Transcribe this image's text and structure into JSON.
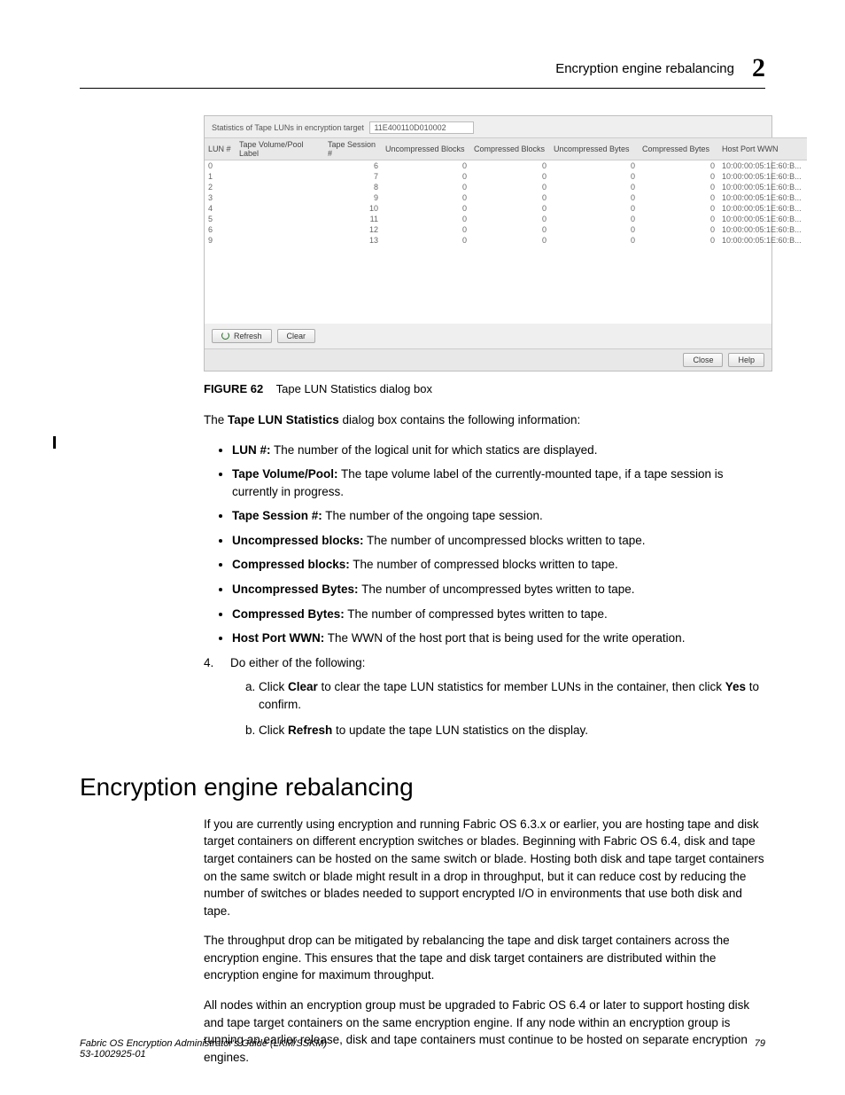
{
  "header": {
    "title": "Encryption engine rebalancing",
    "chapter_number": "2"
  },
  "figure": {
    "stats_label": "Statistics of Tape LUNs in encryption target",
    "target_id": "11E400110D010002",
    "columns": [
      "LUN #",
      "Tape Volume/Pool Label",
      "Tape Session #",
      "Uncompressed Blocks",
      "Compressed Blocks",
      "Uncompressed Bytes",
      "Compressed Bytes",
      "Host Port WWN"
    ],
    "rows": [
      {
        "lun": "0",
        "label": "",
        "session": "6",
        "ub": "0",
        "cb": "0",
        "uby": "0",
        "cby": "0",
        "wwn": "10:00:00:05:1E:60:B..."
      },
      {
        "lun": "1",
        "label": "",
        "session": "7",
        "ub": "0",
        "cb": "0",
        "uby": "0",
        "cby": "0",
        "wwn": "10:00:00:05:1E:60:B..."
      },
      {
        "lun": "2",
        "label": "",
        "session": "8",
        "ub": "0",
        "cb": "0",
        "uby": "0",
        "cby": "0",
        "wwn": "10:00:00:05:1E:60:B..."
      },
      {
        "lun": "3",
        "label": "",
        "session": "9",
        "ub": "0",
        "cb": "0",
        "uby": "0",
        "cby": "0",
        "wwn": "10:00:00:05:1E:60:B..."
      },
      {
        "lun": "4",
        "label": "",
        "session": "10",
        "ub": "0",
        "cb": "0",
        "uby": "0",
        "cby": "0",
        "wwn": "10:00:00:05:1E:60:B..."
      },
      {
        "lun": "5",
        "label": "",
        "session": "11",
        "ub": "0",
        "cb": "0",
        "uby": "0",
        "cby": "0",
        "wwn": "10:00:00:05:1E:60:B..."
      },
      {
        "lun": "6",
        "label": "",
        "session": "12",
        "ub": "0",
        "cb": "0",
        "uby": "0",
        "cby": "0",
        "wwn": "10:00:00:05:1E:60:B..."
      },
      {
        "lun": "9",
        "label": "",
        "session": "13",
        "ub": "0",
        "cb": "0",
        "uby": "0",
        "cby": "0",
        "wwn": "10:00:00:05:1E:60:B..."
      }
    ],
    "refresh_label": "Refresh",
    "clear_label": "Clear",
    "close_label": "Close",
    "help_label": "Help"
  },
  "figure_caption": {
    "label": "FIGURE 62",
    "text": "Tape LUN Statistics dialog box"
  },
  "intro_text": {
    "prefix": "The ",
    "bold": "Tape LUN Statistics",
    "suffix": " dialog box contains the following information:"
  },
  "bullets": [
    {
      "term": "LUN #:",
      "desc": "The number of the logical unit for which statics are displayed."
    },
    {
      "term": "Tape Volume/Pool:",
      "desc": "The tape volume label of the currently-mounted tape, if a tape session is currently in progress."
    },
    {
      "term": "Tape Session #:",
      "desc": "The number of the ongoing tape session."
    },
    {
      "term": "Uncompressed blocks:",
      "desc": "The number of uncompressed blocks written to tape."
    },
    {
      "term": "Compressed blocks:",
      "desc": "The number of compressed blocks written to tape."
    },
    {
      "term": "Uncompressed Bytes:",
      "desc": "The number of uncompressed bytes written to tape."
    },
    {
      "term": "Compressed Bytes:",
      "desc": "The number of compressed bytes written to tape."
    },
    {
      "term": "Host Port WWN:",
      "desc": "The WWN of the host port that is being used for the write operation."
    }
  ],
  "step4": {
    "number": "4.",
    "lead": "Do either of the following:",
    "sub": [
      {
        "pre": "Click ",
        "b1": "Clear",
        "mid": " to clear the tape LUN statistics for member LUNs in the container, then click ",
        "b2": "Yes",
        "post": " to confirm."
      },
      {
        "pre": "Click ",
        "b1": "Refresh",
        "mid": " to update the tape LUN statistics on the display.",
        "b2": "",
        "post": ""
      }
    ]
  },
  "section_heading": "Encryption engine rebalancing",
  "paragraphs": [
    "If you are currently using encryption and running Fabric OS 6.3.x or earlier, you are hosting tape and disk target containers on different encryption switches or blades. Beginning with Fabric OS 6.4, disk and tape target containers can be hosted on the same switch or blade. Hosting both disk and tape target containers on the same switch or blade might result in a drop in throughput, but it can reduce cost by reducing the number of switches or blades needed to support encrypted I/O in environments that use both disk and tape.",
    "The throughput drop can be mitigated by rebalancing the tape and disk target containers across the encryption engine. This ensures that the tape and disk target containers are distributed within the encryption engine for maximum throughput.",
    "All nodes within an encryption group must be upgraded to Fabric OS 6.4 or later to support hosting disk and tape target containers on the same encryption engine. If any node within an encryption group is running an earlier release, disk and tape containers must continue to be hosted on separate encryption engines."
  ],
  "footer": {
    "line1": "Fabric OS Encryption Administrator's Guide  (LKM/SSKM)",
    "line2": "53-1002925-01",
    "page": "79"
  }
}
